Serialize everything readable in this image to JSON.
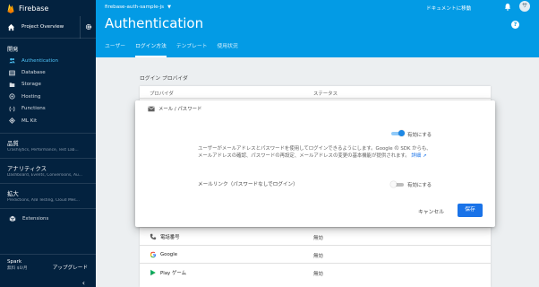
{
  "sidebar": {
    "brand": "Firebase",
    "overview": "Project Overview",
    "develop_title": "開発",
    "develop_items": [
      {
        "label": "Authentication",
        "icon": "people-icon"
      },
      {
        "label": "Database",
        "icon": "database-icon"
      },
      {
        "label": "Storage",
        "icon": "storage-icon"
      },
      {
        "label": "Hosting",
        "icon": "hosting-icon"
      },
      {
        "label": "Functions",
        "icon": "functions-icon"
      },
      {
        "label": "ML Kit",
        "icon": "mlkit-icon"
      }
    ],
    "groups": [
      {
        "title": "品質",
        "sub": "Crashlytics, Performance, Test Lab..."
      },
      {
        "title": "アナリティクス",
        "sub": "Dashboard, Events, Conversions, Au..."
      },
      {
        "title": "拡大",
        "sub": "Predictions, A/B Testing, Cloud Mes..."
      }
    ],
    "extensions": "Extensions",
    "plan_name": "Spark",
    "plan_price": "無料 $0/月",
    "upgrade": "アップグレード",
    "collapse": "‹"
  },
  "header": {
    "project": "firebase-auth-sample-js",
    "docs": "ドキュメントに移動",
    "avatar": "サ",
    "title": "Authentication",
    "help": "?",
    "tabs": [
      "ユーザー",
      "ログイン方法",
      "テンプレート",
      "使用状況"
    ],
    "active_tab": 1
  },
  "main": {
    "section_label": "ログイン プロバイダ",
    "columns": [
      "プロバイダ",
      "ステータス"
    ],
    "rows": [
      {
        "provider": "電話番号",
        "status": "無効",
        "icon": "phone-icon"
      },
      {
        "provider": "Google",
        "status": "無効",
        "icon": "google-icon"
      },
      {
        "provider": "Play ゲーム",
        "status": "無効",
        "icon": "play-games-icon"
      }
    ]
  },
  "dialog": {
    "title": "メール / パスワード",
    "enable_label": "有効にする",
    "enable_on": true,
    "description": "ユーザーがメールアドレスとパスワードを使用してログインできるようにします。Google の SDK からも、メールアドレスの確認、パスワードの再設定、メールアドレスの変更の基本機能が提供されます。",
    "more_link": "詳細",
    "email_link_label": "メールリンク（パスワードなしでログイン）",
    "email_link_enable_label": "有効にする",
    "email_link_on": false,
    "cancel": "キャンセル",
    "save": "保存"
  },
  "colors": {
    "header_blue": "#039be5",
    "sidebar_navy": "#03223f",
    "accent_blue": "#1a73e8",
    "active_nav": "#4fc3f7"
  }
}
